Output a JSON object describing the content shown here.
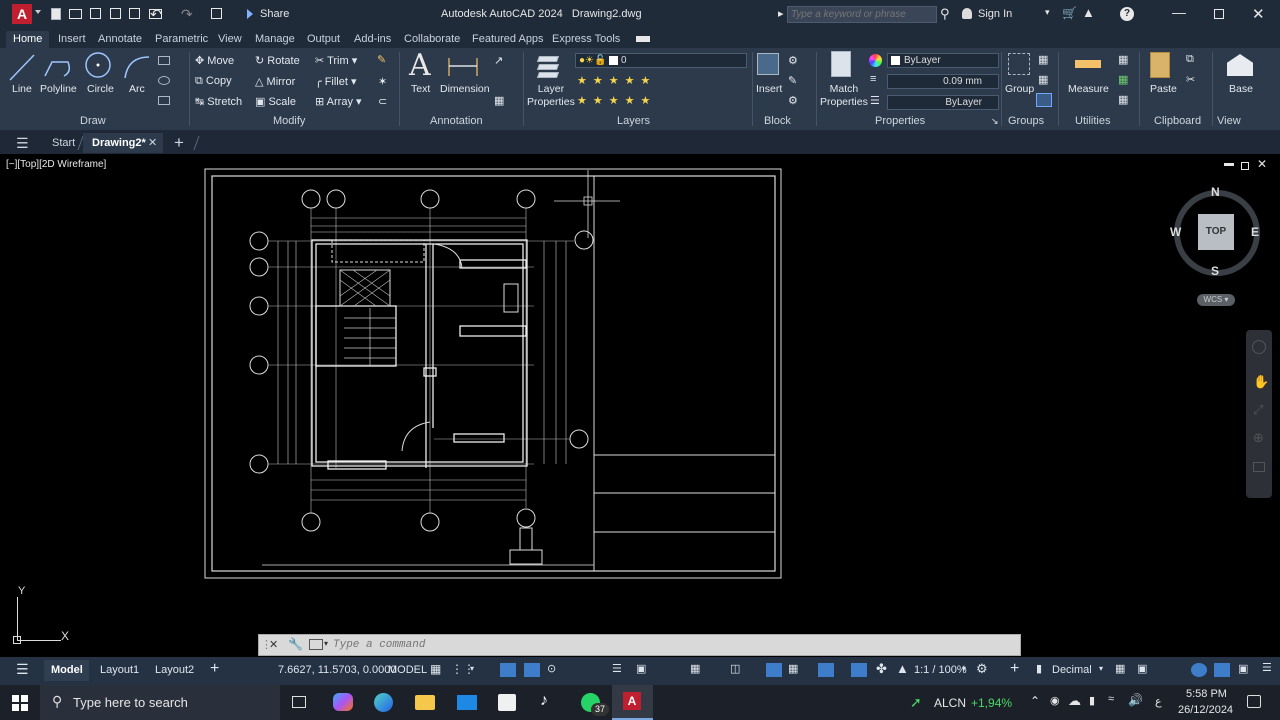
{
  "app": {
    "menu_letter": "A",
    "title": "Autodesk AutoCAD 2024",
    "document": "Drawing2.dwg",
    "share_label": "Share",
    "search_placeholder": "Type a keyword or phrase",
    "sign_in": "Sign In"
  },
  "ribbon_tabs": [
    "Home",
    "Insert",
    "Annotate",
    "Parametric",
    "View",
    "Manage",
    "Output",
    "Add-ins",
    "Collaborate",
    "Featured Apps",
    "Express Tools"
  ],
  "draw_panel": {
    "title": "Draw",
    "line": "Line",
    "polyline": "Polyline",
    "circle": "Circle",
    "arc": "Arc"
  },
  "modify_panel": {
    "title": "Modify",
    "move": "Move",
    "rotate": "Rotate",
    "trim": "Trim",
    "copy": "Copy",
    "mirror": "Mirror",
    "fillet": "Fillet",
    "stretch": "Stretch",
    "scale": "Scale",
    "array": "Array"
  },
  "annotation_panel": {
    "title": "Annotation",
    "text": "Text",
    "dimension": "Dimension"
  },
  "layers_panel": {
    "title": "Layers",
    "layer_properties_1": "Layer",
    "layer_properties_2": "Properties",
    "current_layer": "0"
  },
  "block_panel": {
    "title": "Block",
    "insert": "Insert"
  },
  "properties_panel": {
    "title": "Properties",
    "match_1": "Match",
    "match_2": "Properties",
    "color": "ByLayer",
    "lineweight": "0.09 mm",
    "linetype": "ByLayer"
  },
  "groups_panel": {
    "title": "Groups",
    "group": "Group"
  },
  "utilities_panel": {
    "title": "Utilities",
    "measure": "Measure"
  },
  "clipboard_panel": {
    "title": "Clipboard",
    "paste": "Paste"
  },
  "view_panel": {
    "title": "View",
    "base": "Base"
  },
  "file_tabs": {
    "start": "Start",
    "drawing": "Drawing2*"
  },
  "viewport": {
    "label": "[−][Top][2D Wireframe]"
  },
  "viewcube": {
    "north": "N",
    "south": "S",
    "east": "E",
    "west": "W",
    "top": "TOP",
    "wcs": "WCS"
  },
  "ucs": {
    "x": "X",
    "y": "Y"
  },
  "command": {
    "placeholder": "Type a command"
  },
  "status": {
    "model_tab": "Model",
    "layout1": "Layout1",
    "layout2": "Layout2",
    "coords": "7.6627, 11.5703, 0.0000",
    "model": "MODEL",
    "scale": "1:1 / 100%",
    "units": "Decimal"
  },
  "taskbar": {
    "search": "Type here to search",
    "stock_name": "ALCN",
    "stock_change": "+1,94%",
    "lang": "ع",
    "time": "5:58 PM",
    "date": "26/12/2024",
    "whatsapp_badge": "37"
  },
  "colors": {
    "accent": "#c01f2f",
    "ribbon": "#2c3a4b",
    "canvas": "#000000",
    "stock_up": "#4cd964"
  }
}
